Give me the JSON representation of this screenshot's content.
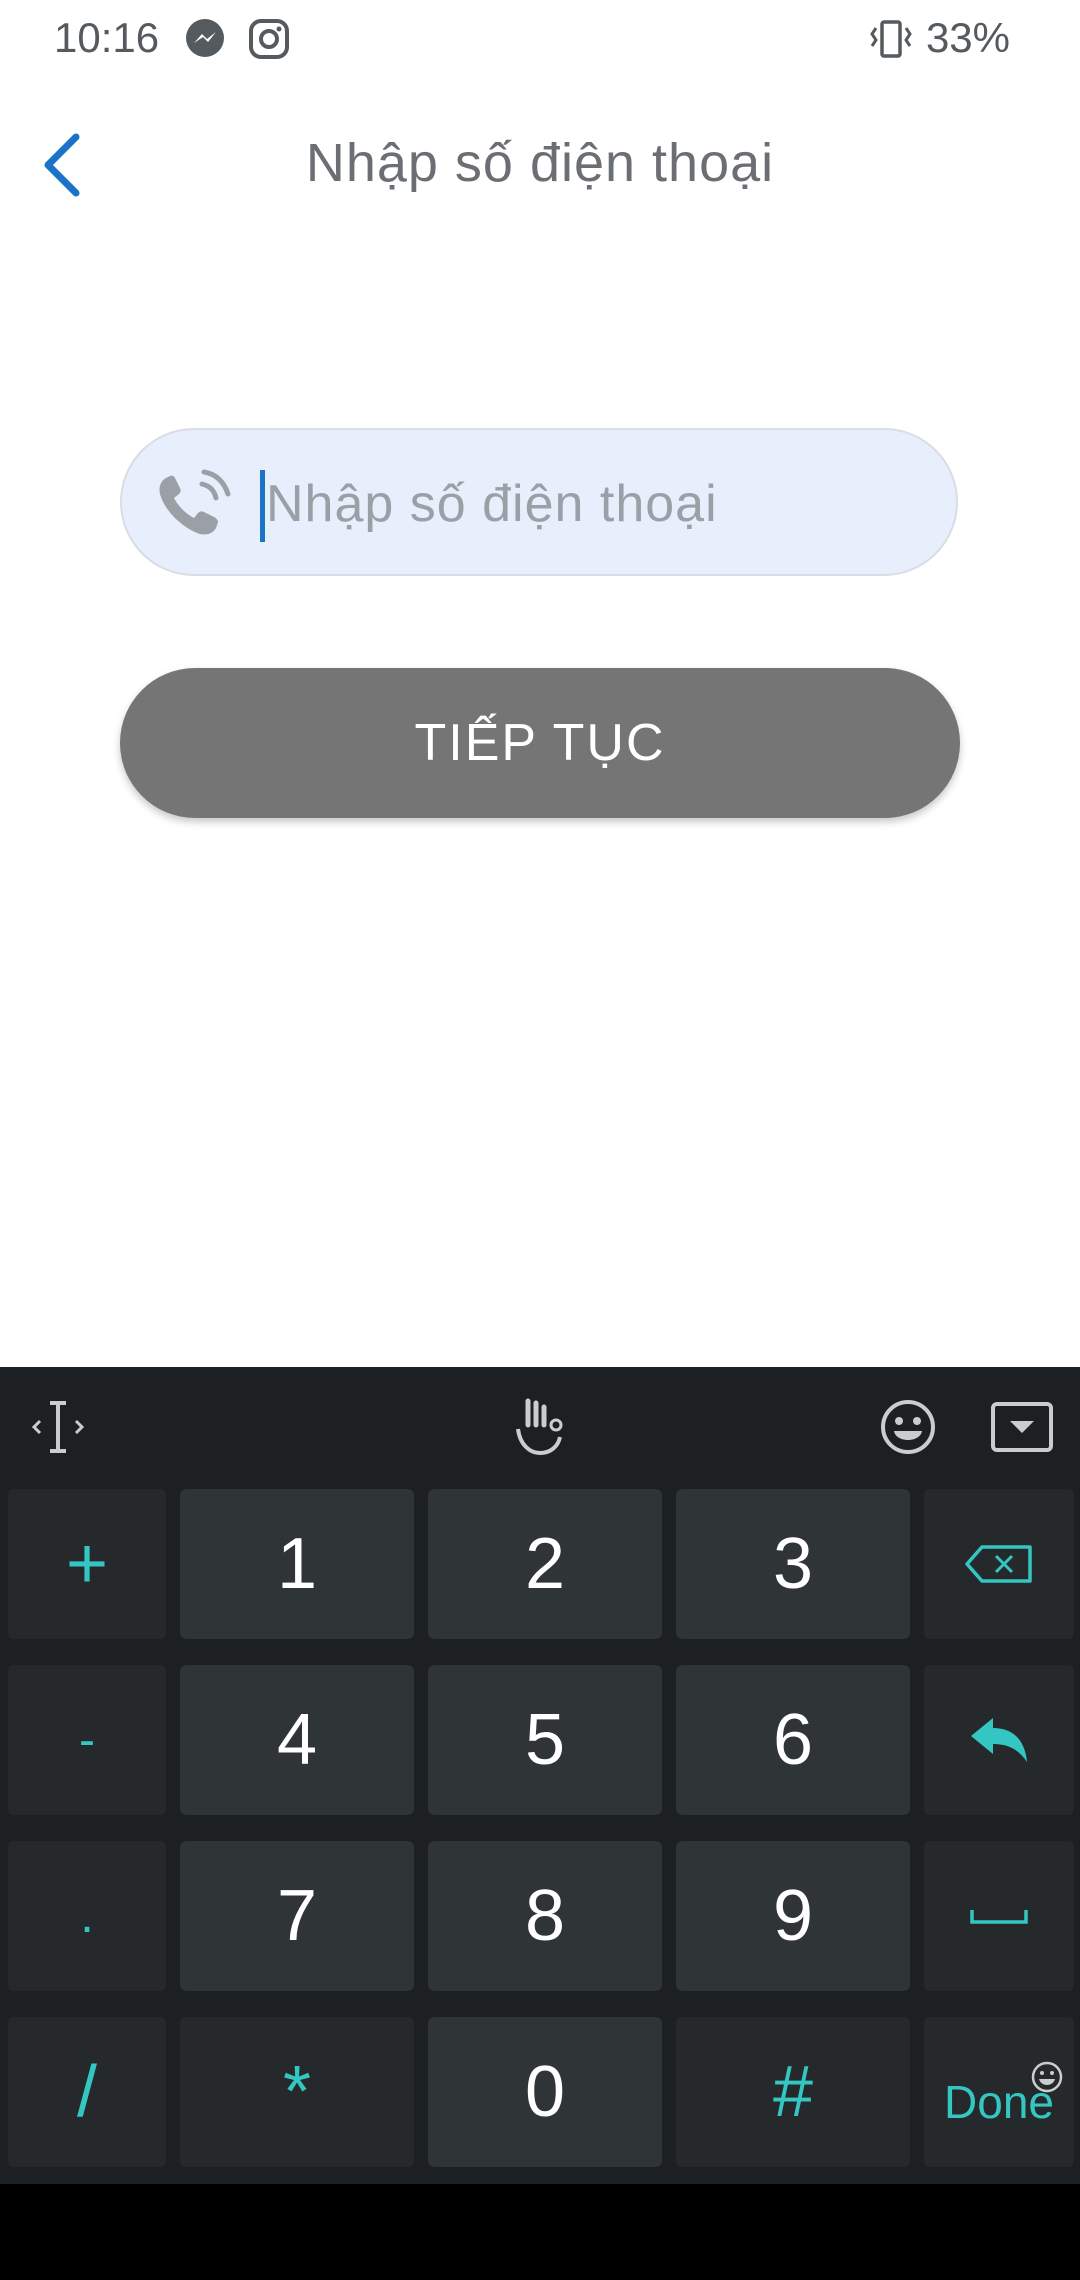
{
  "status_bar": {
    "time": "10:16",
    "battery": "33%"
  },
  "header": {
    "title": "Nhập số điện thoại"
  },
  "phone_field": {
    "placeholder": "Nhập số điện thoại",
    "value": ""
  },
  "continue_button": {
    "label": "TIẾP TỤC"
  },
  "keyboard": {
    "rows": [
      [
        "+",
        "1",
        "2",
        "3"
      ],
      [
        "-",
        "4",
        "5",
        "6"
      ],
      [
        ".",
        "7",
        "8",
        "9"
      ],
      [
        "/",
        "*",
        "0",
        "#",
        "Done"
      ]
    ]
  },
  "colors": {
    "accent": "#1a73c7",
    "button": "#757575",
    "keyboard_accent": "#34c6c2",
    "field_bg": "#e8effc"
  }
}
